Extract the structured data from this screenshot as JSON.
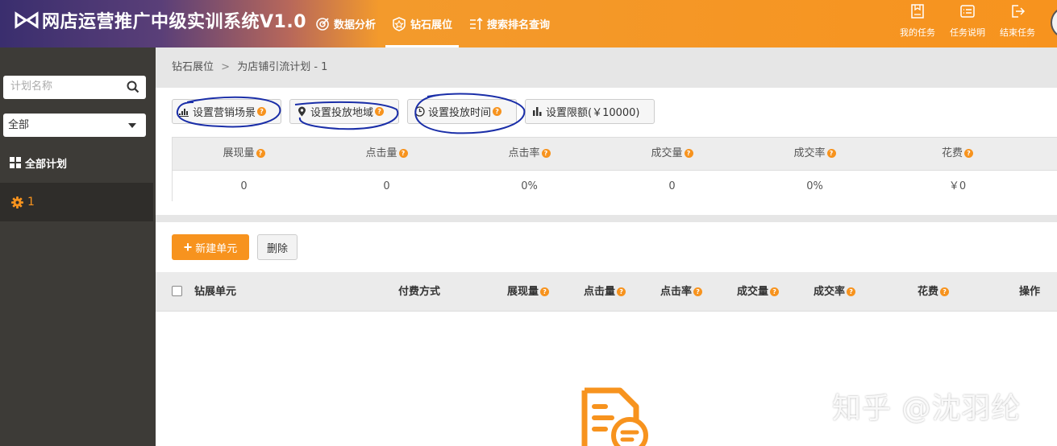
{
  "header": {
    "title": "网店运营推广中级实训系统V1.0",
    "nav": [
      {
        "label": "数据分析",
        "icon": "target-icon"
      },
      {
        "label": "钻石展位",
        "icon": "diamond-badge-icon"
      },
      {
        "label": "搜索排名查询",
        "icon": "sort-list-icon"
      }
    ],
    "tools": [
      {
        "label": "我的任务",
        "icon": "task-doc-icon"
      },
      {
        "label": "任务说明",
        "icon": "list-card-icon"
      },
      {
        "label": "结束任务",
        "icon": "logout-icon"
      }
    ]
  },
  "sidebar": {
    "search_placeholder": "计划名称",
    "filter_value": "全部",
    "all_plans_label": "全部计划",
    "plan_item_label": "1"
  },
  "breadcrumb": {
    "root": "钻石展位",
    "sep": ">",
    "current": "为店铺引流计划 - 1"
  },
  "settings": {
    "scene": "设置营销场景",
    "region": "设置投放地域",
    "time": "设置投放时间",
    "budget": "设置限额(￥10000)",
    "help_mark": "?"
  },
  "stats": {
    "headers": [
      "展现量",
      "点击量",
      "点击率",
      "成交量",
      "成交率",
      "花费"
    ],
    "values": [
      "0",
      "0",
      "0%",
      "0",
      "0%",
      "￥0"
    ]
  },
  "actions": {
    "new_unit": "新建单元",
    "delete": "删除"
  },
  "unit_table": {
    "headers": [
      "钻展单元",
      "付费方式",
      "展现量",
      "点击量",
      "点击率",
      "成交量",
      "成交率",
      "花费",
      "操作"
    ]
  },
  "watermark": "知乎 @沈羽纶",
  "colors": {
    "accent": "#f7931e",
    "sidebar_bg": "#3d3b37",
    "annotation_ink": "#1a2ea8"
  }
}
